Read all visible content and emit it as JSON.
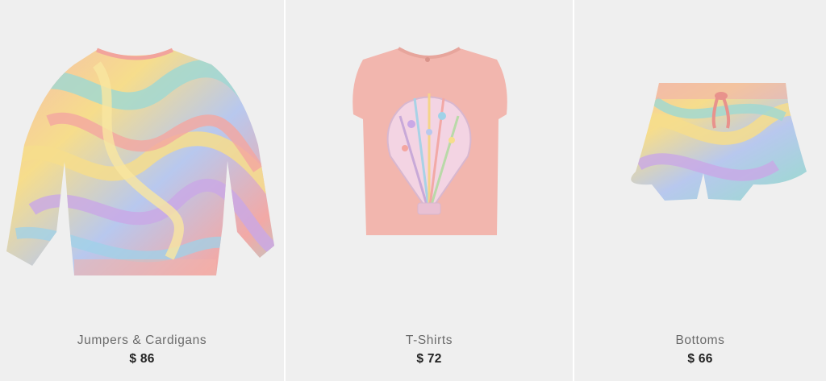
{
  "products": [
    {
      "category": "Jumpers & Cardigans",
      "price": "$ 86",
      "icon": "marble-print-jumper"
    },
    {
      "category": "T-Shirts",
      "price": "$ 72",
      "icon": "seashell-tshirt"
    },
    {
      "category": "Bottoms",
      "price": "$ 66",
      "icon": "marble-print-shorts"
    }
  ],
  "colors": {
    "card_bg": "#efefef",
    "label": "#6a6a6a",
    "price": "#222222",
    "tee_pink": "#f2b6ae"
  }
}
